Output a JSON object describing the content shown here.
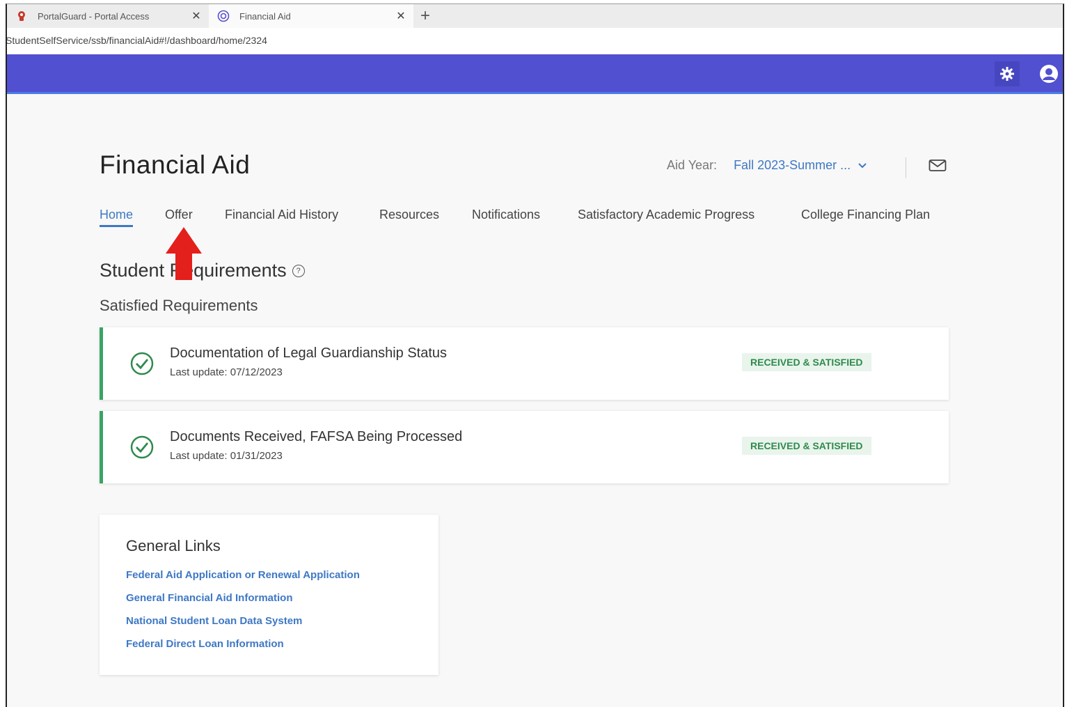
{
  "browser": {
    "tabs": [
      {
        "title": "PortalGuard - Portal Access",
        "icon": "portalguard-icon"
      },
      {
        "title": "Financial Aid",
        "icon": "financial-aid-icon"
      }
    ],
    "new_tab_label": "+",
    "url": "StudentSelfService/ssb/financialAid#!/dashboard/home/2324"
  },
  "header": {
    "accent_color": "#5150d0",
    "icons": [
      "gear-icon",
      "user-icon"
    ]
  },
  "page": {
    "title": "Financial Aid",
    "aid_year_label": "Aid Year:",
    "aid_year_value": "Fall 2023-Summer ...",
    "nav_tabs": [
      "Home",
      "Offer",
      "Financial Aid History",
      "Resources",
      "Notifications",
      "Satisfactory Academic Progress",
      "College Financing Plan"
    ],
    "active_tab": "Home"
  },
  "requirements": {
    "title": "Student Requirements",
    "subtitle": "Satisfied Requirements",
    "items": [
      {
        "name": "Documentation of Legal Guardianship Status",
        "last_update": "Last update: 07/12/2023",
        "status": "RECEIVED & SATISFIED"
      },
      {
        "name": "Documents Received, FAFSA Being Processed",
        "last_update": "Last update: 01/31/2023",
        "status": "RECEIVED & SATISFIED"
      }
    ],
    "status_color": "#2f8a4c"
  },
  "general_links": {
    "title": "General Links",
    "links": [
      "Federal Aid Application or Renewal Application",
      "General Financial Aid Information",
      "National Student Loan Data System",
      "Federal Direct Loan Information"
    ],
    "link_color": "#3e78c4"
  }
}
